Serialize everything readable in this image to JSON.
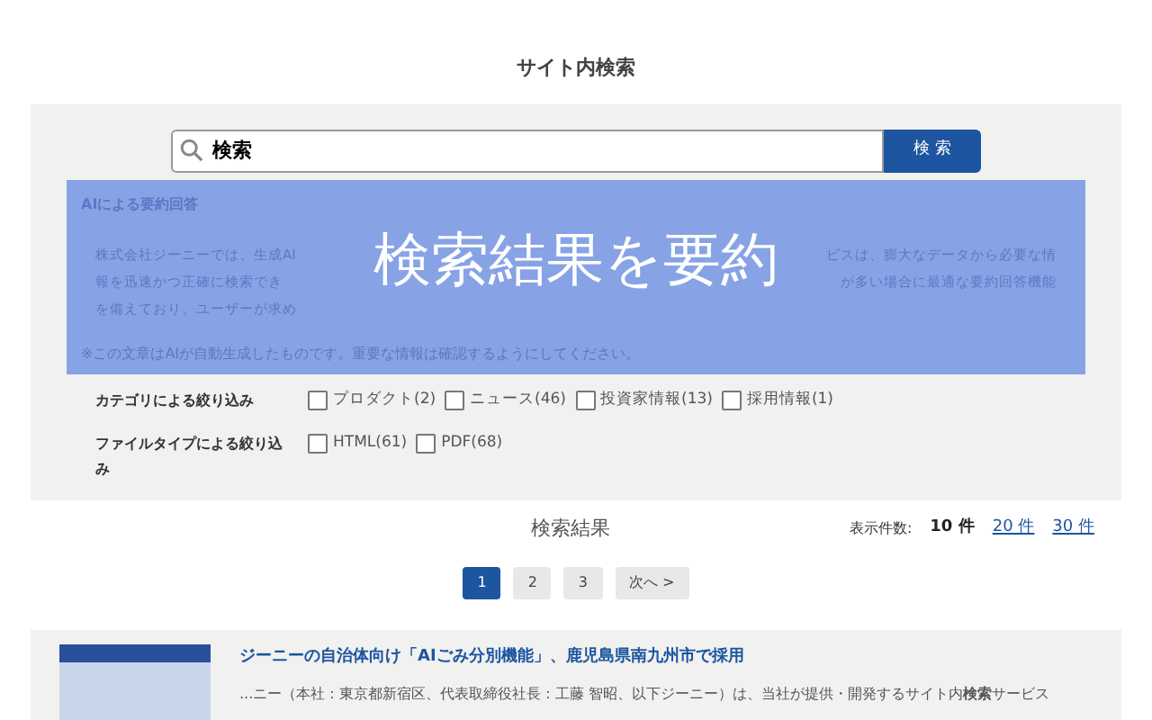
{
  "page_title": "サイト内検索",
  "search": {
    "value": "検索",
    "button": "検 索"
  },
  "ai_summary": {
    "heading": "AIによる要約回答",
    "lines": [
      {
        "left": "株式会社ジーニーでは、生成AI",
        "right": "ビスは、膨大なデータから必要な情"
      },
      {
        "left": "報を迅速かつ正確に検索でき",
        "right": "が多い場合に最適な要約回答機能"
      },
      {
        "left": "を備えており、ユーザーが求め"
      }
    ],
    "note": "※この文章はAIが自動生成したものです。重要な情報は確認するようにしてください。",
    "overlay": "検索結果を要約"
  },
  "filters": [
    {
      "label": "カテゴリによる絞り込み",
      "options": [
        {
          "label": "プロダクト(2)",
          "checked": false
        },
        {
          "label": "ニュース(46)",
          "checked": false
        },
        {
          "label": "投資家情報(13)",
          "checked": false
        },
        {
          "label": "採用情報(1)",
          "checked": false
        }
      ]
    },
    {
      "label": "ファイルタイプによる絞り込み",
      "options": [
        {
          "label": "HTML(61)",
          "checked": false
        },
        {
          "label": "PDF(68)",
          "checked": false
        }
      ]
    }
  ],
  "results_heading": "検索結果",
  "per_page": {
    "label": "表示件数:",
    "options": [
      {
        "label": "10 件",
        "selected": true
      },
      {
        "label": "20 件",
        "selected": false
      },
      {
        "label": "30 件",
        "selected": false
      }
    ]
  },
  "pagination": [
    {
      "label": "1",
      "selected": true
    },
    {
      "label": "2",
      "selected": false
    },
    {
      "label": "3",
      "selected": false
    },
    {
      "label": "次へ >",
      "selected": false
    }
  ],
  "results": [
    {
      "title": "ジーニーの自治体向け「AIごみ分別機能」、鹿児島県南九州市で採用",
      "snippet": "...ニー（本社：東京都新宿区、代表取締役社長：工藤 智昭、以下ジーニー）は、当社が提供・開発するサイト内**検索**サービス"
    }
  ]
}
